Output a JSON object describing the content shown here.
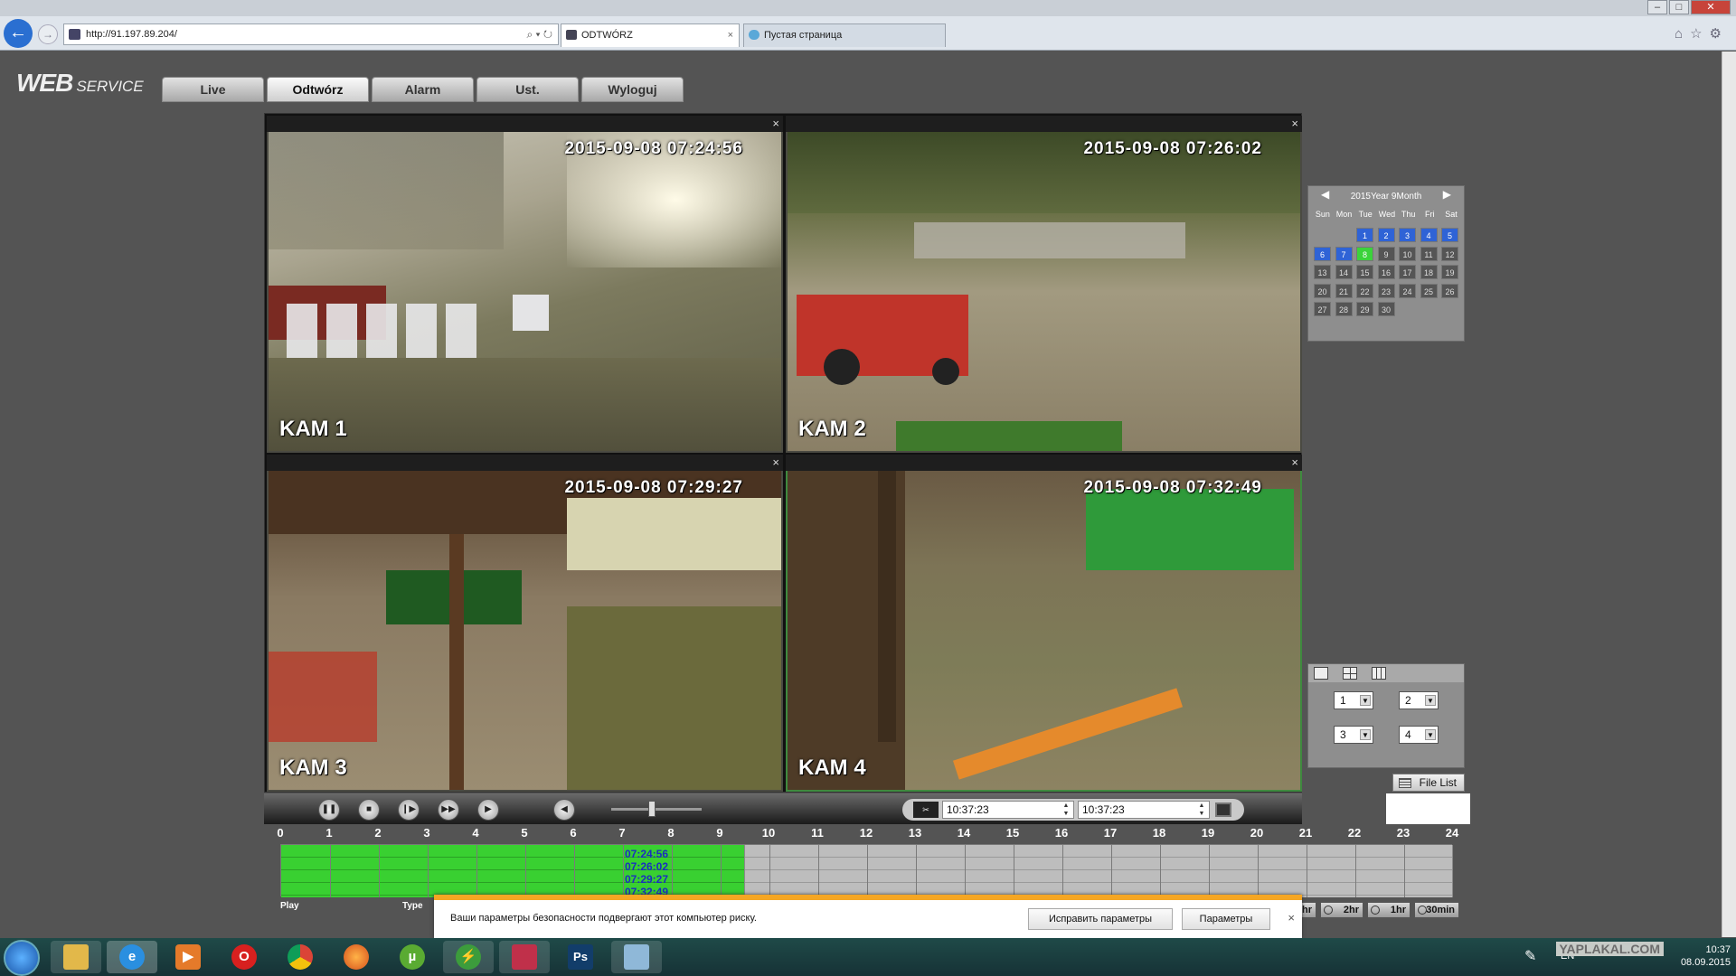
{
  "browser": {
    "url": "http://91.197.89.204/",
    "tabs": [
      {
        "title": "ODTWÓRZ",
        "active": true
      },
      {
        "title": "Пустая страница",
        "active": false
      }
    ]
  },
  "app": {
    "logo_main": "WEB",
    "logo_sub": "SERVICE",
    "nav": [
      "Live",
      "Odtwórz",
      "Alarm",
      "Ust.",
      "Wyloguj"
    ],
    "active_nav": "Odtwórz"
  },
  "cameras": [
    {
      "name": "KAM 1",
      "timestamp": "2015-09-08  07:24:56"
    },
    {
      "name": "KAM 2",
      "timestamp": "2015-09-08  07:26:02"
    },
    {
      "name": "KAM 3",
      "timestamp": "2015-09-08  07:29:27"
    },
    {
      "name": "KAM 4",
      "timestamp": "2015-09-08  07:32:49"
    }
  ],
  "calendar": {
    "header": "2015Year 9Month",
    "weekdays": [
      "Sun",
      "Mon",
      "Tue",
      "Wed",
      "Thu",
      "Fri",
      "Sat"
    ],
    "first_weekday": 2,
    "days_in_month": 30,
    "recorded_days": [
      1,
      2,
      3,
      4,
      5,
      6,
      7,
      8
    ],
    "current_day": 8
  },
  "layout_panel": {
    "channels": [
      "1",
      "2",
      "3",
      "4"
    ]
  },
  "file_list_label": "File List",
  "playback": {
    "start_time": "10:37:23",
    "end_time": "10:37:23",
    "slider_level": 0.45
  },
  "timeline": {
    "hours": [
      "0",
      "1",
      "2",
      "3",
      "4",
      "5",
      "6",
      "7",
      "8",
      "9",
      "10",
      "11",
      "12",
      "13",
      "14",
      "15",
      "16",
      "17",
      "18",
      "19",
      "20",
      "21",
      "22",
      "23",
      "24"
    ],
    "record_end_hour": 9.5,
    "record_times": [
      "07:24:56",
      "07:26:02",
      "07:29:27",
      "07:32:49"
    ],
    "labels": {
      "play": "Play",
      "type": "Type"
    },
    "zoom": [
      "hr",
      "2hr",
      "1hr",
      "30min"
    ]
  },
  "security_bar": {
    "message": "Ваши параметры безопасности подвергают этот компьютер риску.",
    "fix_button": "Исправить параметры",
    "params_button": "Параметры"
  },
  "taskbar": {
    "apps": [
      "explorer",
      "internet-explorer",
      "media-player",
      "opera",
      "chrome",
      "firefox",
      "utorrent",
      "torrent-alt",
      "calendar-app",
      "photoshop",
      "paint"
    ],
    "language": "EN",
    "time": "10:37",
    "date": "08.09.2015",
    "watermark": "YAPLAKAL.COM"
  },
  "colors": {
    "recorded": "#39d031",
    "record_day": "#2f63d6",
    "current_day": "#3bd33b",
    "warning_bar": "#f5a623"
  }
}
